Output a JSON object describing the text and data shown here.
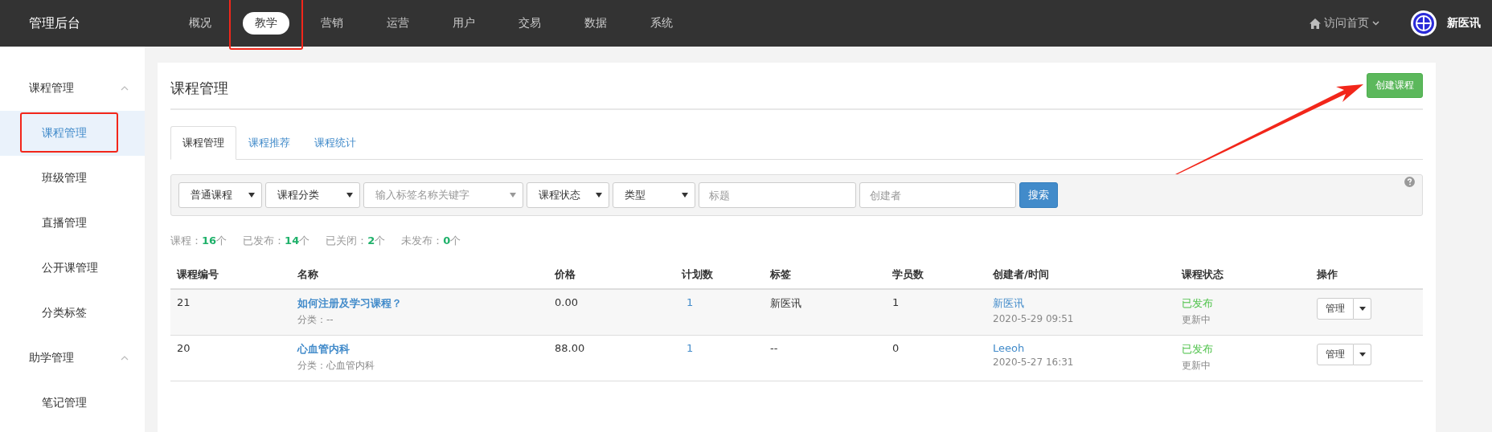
{
  "topbar": {
    "brand": "管理后台",
    "nav": [
      {
        "label": "概况",
        "selected": false,
        "annotated": false
      },
      {
        "label": "教学",
        "selected": true,
        "annotated": true
      },
      {
        "label": "营销",
        "selected": false,
        "annotated": false
      },
      {
        "label": "运营",
        "selected": false,
        "annotated": false
      },
      {
        "label": "用户",
        "selected": false,
        "annotated": false
      },
      {
        "label": "交易",
        "selected": false,
        "annotated": false
      },
      {
        "label": "数据",
        "selected": false,
        "annotated": false
      },
      {
        "label": "系统",
        "selected": false,
        "annotated": false
      }
    ],
    "home_link": "访问首页",
    "user_name": "新医讯"
  },
  "sidebar": {
    "groups": [
      {
        "label": "课程管理",
        "expanded": true,
        "items": [
          {
            "label": "课程管理",
            "selected": true,
            "annotated": true
          },
          {
            "label": "班级管理",
            "selected": false,
            "annotated": false
          },
          {
            "label": "直播管理",
            "selected": false,
            "annotated": false
          },
          {
            "label": "公开课管理",
            "selected": false,
            "annotated": false
          },
          {
            "label": "分类标签",
            "selected": false,
            "annotated": false
          }
        ]
      },
      {
        "label": "助学管理",
        "expanded": true,
        "items": [
          {
            "label": "笔记管理",
            "selected": false,
            "annotated": false
          }
        ]
      }
    ]
  },
  "page": {
    "title": "课程管理",
    "create_button": {
      "label": "创建课程",
      "arrow_annotation": true
    },
    "tabs": [
      {
        "label": "课程管理",
        "selected": true
      },
      {
        "label": "课程推荐",
        "selected": false
      },
      {
        "label": "课程统计",
        "selected": false
      }
    ],
    "filters": [
      {
        "kind": "select",
        "value": "普通课程"
      },
      {
        "kind": "select",
        "value": "课程分类"
      },
      {
        "kind": "select",
        "placeholder": "输入标签名称关键字"
      },
      {
        "kind": "select",
        "value": "课程状态"
      },
      {
        "kind": "select",
        "value": "类型"
      },
      {
        "kind": "input",
        "placeholder": "标题"
      },
      {
        "kind": "input",
        "placeholder": "创建者"
      },
      {
        "kind": "button",
        "label": "搜索"
      }
    ],
    "stats": [
      {
        "label": "课程：",
        "count": "16",
        "unit": "个"
      },
      {
        "label": "已发布：",
        "count": "14",
        "unit": "个"
      },
      {
        "label": "已关闭：",
        "count": "2",
        "unit": "个"
      },
      {
        "label": "未发布：",
        "count": "0",
        "unit": "个"
      }
    ],
    "table": {
      "columns": [
        "课程编号",
        "名称",
        "价格",
        "计划数",
        "标签",
        "学员数",
        "创建者/时间",
        "课程状态",
        "操作"
      ],
      "rows": [
        {
          "id": "21",
          "name": "如何注册及学习课程？",
          "category": "分类：--",
          "price": "0.00",
          "plans": "1",
          "tag": "新医讯",
          "students": "1",
          "creator": "新医讯",
          "time": "2020-5-29 09:51",
          "status": "已发布",
          "status_note": "更新中",
          "action": "管理"
        },
        {
          "id": "20",
          "name": "心血管内科",
          "category": "分类：心血管内科",
          "price": "88.00",
          "plans": "1",
          "tag": "--",
          "students": "0",
          "creator": "Leeoh",
          "time": "2020-5-27 16:31",
          "status": "已发布",
          "status_note": "更新中",
          "action": "管理"
        }
      ]
    }
  }
}
